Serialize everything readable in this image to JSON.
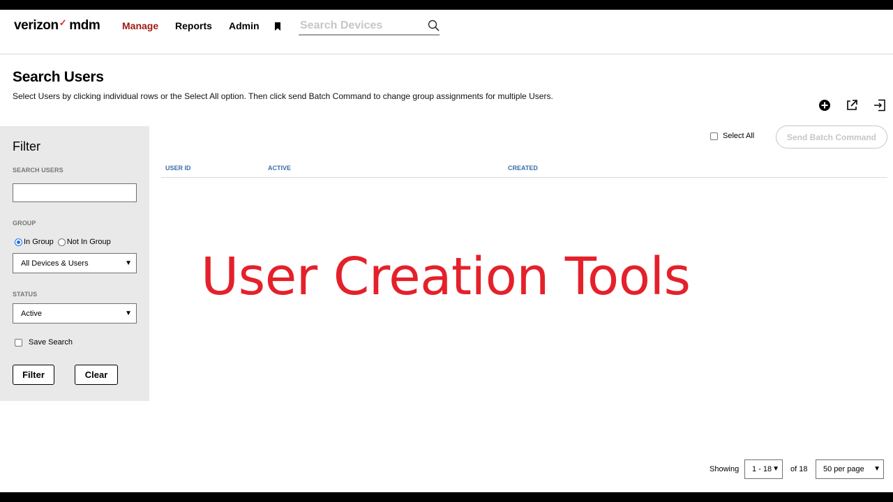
{
  "header": {
    "logo_brand": "verizon",
    "logo_check": "✓",
    "logo_product": "mdm",
    "nav": [
      {
        "label": "Manage",
        "active": true
      },
      {
        "label": "Reports",
        "active": false
      },
      {
        "label": "Admin",
        "active": false
      }
    ],
    "bookmark_icon": "bookmark-icon",
    "search_placeholder": "Search Devices",
    "search_icon": "search-icon"
  },
  "page": {
    "title": "Search Users",
    "subtitle": "Select Users by clicking individual rows or the Select All option. Then click send Batch Command to change group assignments for multiple Users."
  },
  "toolbar": {
    "icons": [
      "add-circle-icon",
      "export-icon",
      "import-icon"
    ]
  },
  "filter": {
    "title": "Filter",
    "search_label": "SEARCH USERS",
    "search_value": "",
    "group_label": "GROUP",
    "radio_in_group": "In Group",
    "radio_not_in_group": "Not In Group",
    "group_selected": "in_group",
    "group_select_value": "All Devices & Users",
    "status_label": "STATUS",
    "status_select_value": "Active",
    "save_search_label": "Save Search",
    "filter_button": "Filter",
    "clear_button": "Clear"
  },
  "results": {
    "select_all_label": "Select All",
    "batch_button": "Send Batch Command",
    "columns": [
      "USER ID",
      "ACTIVE",
      "CREATED"
    ]
  },
  "overlay": {
    "text": "User Creation Tools",
    "color": "#e4212b"
  },
  "pagination": {
    "showing_label": "Showing",
    "range_value": "1 - 18",
    "of_text": "of 18",
    "per_page_value": "50 per page"
  },
  "colors": {
    "brand_red": "#d52b1e",
    "active_nav": "#a11a13",
    "column_header": "#3b6ea5",
    "filter_bg": "#e9e9e9"
  }
}
